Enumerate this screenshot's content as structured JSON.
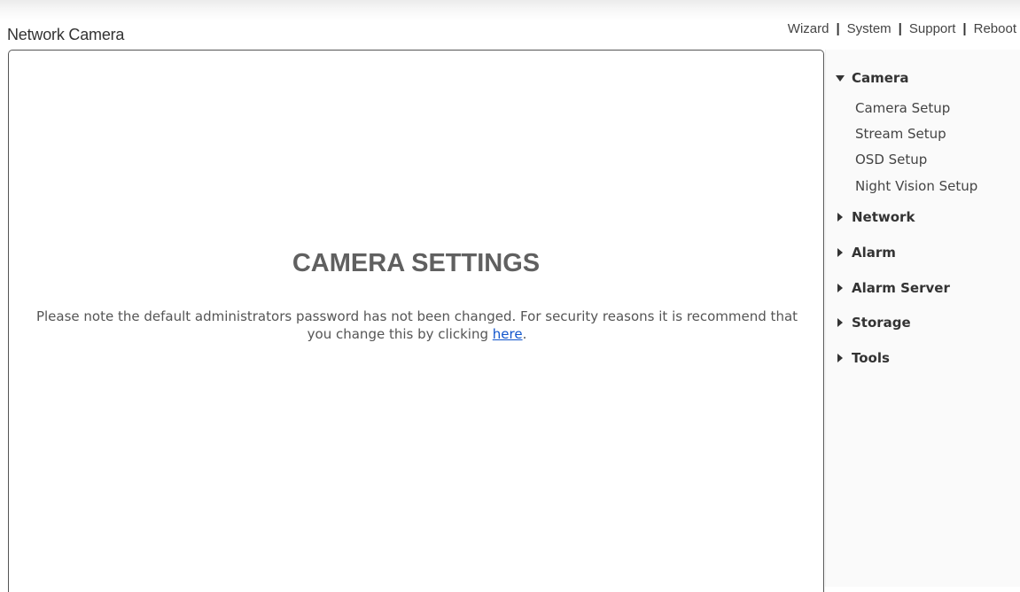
{
  "header": {
    "title": "Network Camera",
    "nav": [
      "Wizard",
      "System",
      "Support",
      "Reboot"
    ],
    "separator": "|"
  },
  "main": {
    "title": "CAMERA SETTINGS",
    "notice_text": "Please note the default administrators password has not been changed. For security reasons it is recommend that you change this by clicking ",
    "notice_link": "here",
    "notice_end": "."
  },
  "sidebar": {
    "sections": [
      {
        "label": "Camera",
        "expanded": true,
        "items": [
          "Camera Setup",
          "Stream Setup",
          "OSD Setup",
          "Night Vision Setup"
        ]
      },
      {
        "label": "Network",
        "expanded": false
      },
      {
        "label": "Alarm",
        "expanded": false
      },
      {
        "label": "Alarm Server",
        "expanded": false
      },
      {
        "label": "Storage",
        "expanded": false
      },
      {
        "label": "Tools",
        "expanded": false
      }
    ]
  },
  "colors": {
    "link": "#1155cc",
    "heading": "#606060",
    "text": "#555555"
  }
}
